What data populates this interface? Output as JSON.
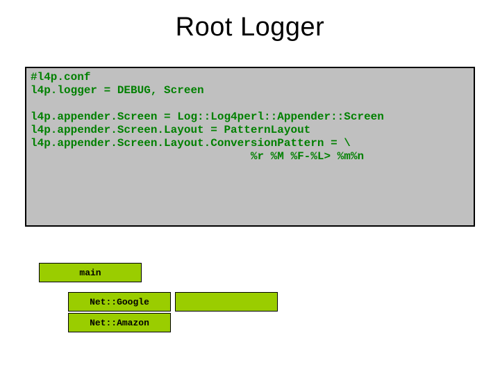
{
  "title": "Root Logger",
  "code": {
    "l1": "#l4p.conf",
    "l2": "l4p.logger = DEBUG, Screen",
    "l3": "",
    "l4": "l4p.appender.Screen = Log::Log4perl::Appender::Screen",
    "l5": "l4p.appender.Screen.Layout = PatternLayout",
    "l6": "l4p.appender.Screen.Layout.ConversionPattern = \\",
    "l7": "                                 %r %M %F-%L> %m%n"
  },
  "diagram": {
    "main": "main",
    "google": "Net::Google",
    "empty": "",
    "amazon": "Net::Amazon"
  }
}
